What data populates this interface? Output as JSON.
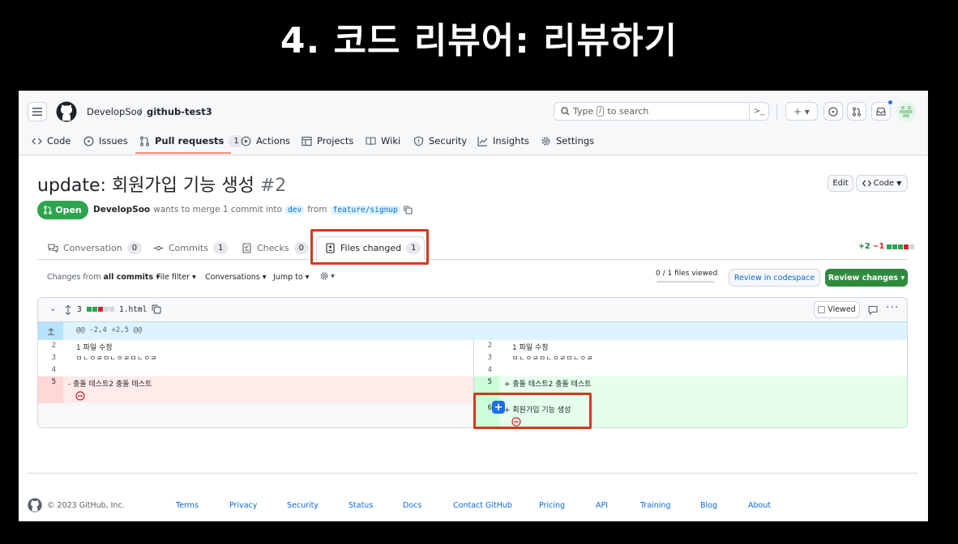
{
  "slide_title": "4. 코드 리뷰어: 리뷰하기",
  "header": {
    "owner": "DevelopSoo",
    "separator": "/",
    "repo": "github-test3",
    "search_prefix": "Type",
    "search_key": "/",
    "search_suffix": "to search",
    "terminal_glyph": ">_",
    "plus_label": "+ ▾"
  },
  "repo_tabs": [
    {
      "label": "Code"
    },
    {
      "label": "Issues"
    },
    {
      "label": "Pull requests",
      "count": "1"
    },
    {
      "label": "Actions"
    },
    {
      "label": "Projects"
    },
    {
      "label": "Wiki"
    },
    {
      "label": "Security"
    },
    {
      "label": "Insights"
    },
    {
      "label": "Settings"
    }
  ],
  "pr": {
    "title": "update: 회원가입 기능 생성",
    "number": "#2",
    "edit_label": "Edit",
    "code_label": "Code",
    "state": "Open",
    "author": "DevelopSoo",
    "merge_text": "wants to merge 1 commit into",
    "base": "dev",
    "from_text": "from",
    "head": "feature/signup"
  },
  "pr_tabs": [
    {
      "label": "Conversation",
      "count": "0"
    },
    {
      "label": "Commits",
      "count": "1"
    },
    {
      "label": "Checks",
      "count": "0"
    },
    {
      "label": "Files changed",
      "count": "1"
    }
  ],
  "diffstat": {
    "add": "+2",
    "del": "−1"
  },
  "toolbar": {
    "changes_from": "Changes from",
    "all_commits": "all commits ▾",
    "file_filter": "File filter ▾",
    "conversations": "Conversations ▾",
    "jump_to": "Jump to ▾",
    "gear_caret": "▾",
    "files_viewed": "0 / 1 files viewed",
    "review_codespace": "Review in codespace",
    "review_changes": "Review changes ▾"
  },
  "file": {
    "count": "3",
    "name": "1.html",
    "viewed_label": "Viewed",
    "hunk": "@@ -2,4 +2,5 @@"
  },
  "diff_left": [
    {
      "num": "2",
      "text": "1 파일 수정"
    },
    {
      "num": "3",
      "text": "ㅁㄴㅇㄹㅁㄴㅇㄹㅁㄴㅇㄹ"
    },
    {
      "num": "4",
      "text": ""
    },
    {
      "num": "5",
      "text": "- 충돌 테스트2 충돌 테스트"
    }
  ],
  "diff_right": [
    {
      "num": "2",
      "text": "1 파일 수정"
    },
    {
      "num": "3",
      "text": "ㅁㄴㅇㄹㅁㄴㅇㄹㅁㄴㅇㄹ"
    },
    {
      "num": "4",
      "text": ""
    },
    {
      "num": "5",
      "text": "+ 충돌 테스트2 충돌 테스트"
    },
    {
      "num": "6",
      "text": "+ 회원가입 기능 생성"
    }
  ],
  "footer": {
    "copyright": "© 2023 GitHub, Inc.",
    "links": [
      "Terms",
      "Privacy",
      "Security",
      "Status",
      "Docs",
      "Contact GitHub",
      "Pricing",
      "API",
      "Training",
      "Blog",
      "About"
    ]
  },
  "colors": {
    "accent_red": "#d03a1f",
    "open_green": "#2da44e",
    "review_green": "#2f8a3e",
    "add_bg": "#e6ffec",
    "del_bg": "#ffebe9",
    "hunk_bg": "#ddf4ff"
  }
}
